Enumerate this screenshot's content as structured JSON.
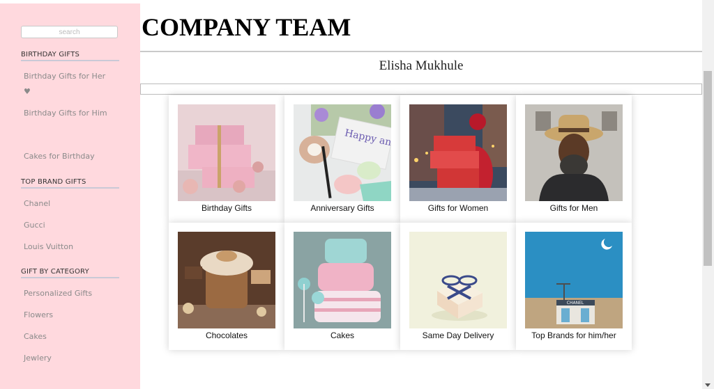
{
  "sidebar": {
    "search_placeholder": "search",
    "sections": [
      {
        "title": "BIRTHDAY GIFTS",
        "items": [
          "Birthday Gifts for Her ♥",
          "Birthday Gifts for Him",
          "Cakes for Birthday"
        ]
      },
      {
        "title": "TOP BRAND GIFTS",
        "items": [
          "Chanel",
          "Gucci",
          "Louis Vuitton"
        ]
      },
      {
        "title": "GIFT BY CATEGORY",
        "items": [
          "Personalized Gifts",
          "Flowers",
          "Cakes",
          "Jewlery"
        ]
      }
    ]
  },
  "header": {
    "title": "COMPANY TEAM",
    "name": "Elisha Mukhule"
  },
  "cards": [
    {
      "label": "Birthday Gifts",
      "image": "pink-gift-boxes-image"
    },
    {
      "label": "Anniversary Gifts",
      "image": "happy-anniversary-card-image",
      "image_text": "Happy anniversary"
    },
    {
      "label": "Gifts for Women",
      "image": "woman-carrying-gifts-image"
    },
    {
      "label": "Gifts for Men",
      "image": "man-in-hat-image"
    },
    {
      "label": "Chocolates",
      "image": "chocolate-cake-image"
    },
    {
      "label": "Cakes",
      "image": "pink-cake-image"
    },
    {
      "label": "Same Day Delivery",
      "image": "small-gift-box-image"
    },
    {
      "label": "Top Brands for him/her",
      "image": "chanel-store-image",
      "image_text": "CHANEL"
    }
  ],
  "colors": {
    "sidebar_bg": "#ffd9de",
    "link": "#8a8a8a"
  }
}
